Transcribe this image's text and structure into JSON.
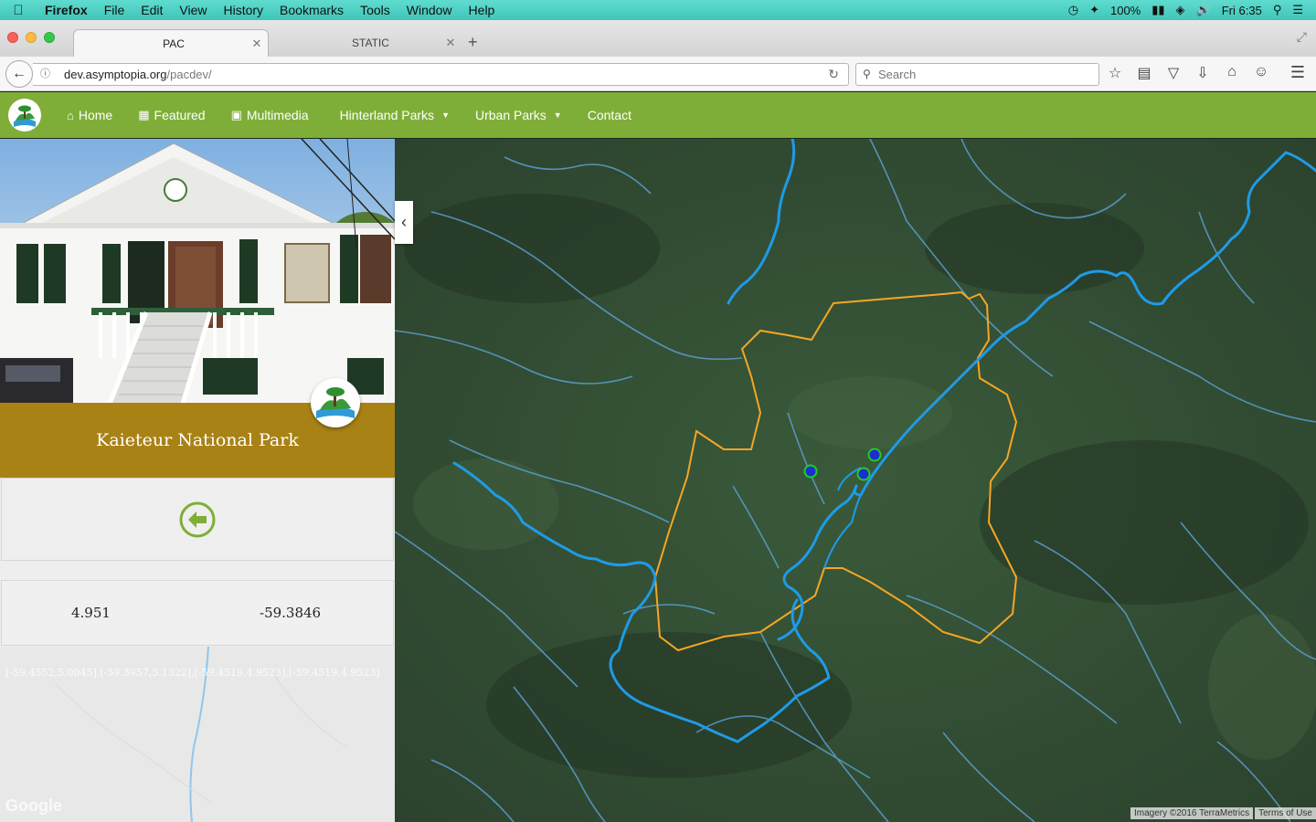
{
  "os_menubar": {
    "app": "Firefox",
    "items": [
      "File",
      "Edit",
      "View",
      "History",
      "Bookmarks",
      "Tools",
      "Window",
      "Help"
    ],
    "battery": "100%",
    "clock": "Fri 6:35"
  },
  "browser": {
    "tabs": [
      {
        "label": "PAC",
        "active": true
      },
      {
        "label": "STATIC",
        "active": false
      }
    ],
    "url_host": "dev.asymptopia.org",
    "url_path": "/pacdev/",
    "search_placeholder": "Search"
  },
  "site_nav": {
    "items": [
      {
        "label": "Home",
        "icon": "home-icon"
      },
      {
        "label": "Featured",
        "icon": "film-icon"
      },
      {
        "label": "Multimedia",
        "icon": "image-icon"
      },
      {
        "label": "Hinterland Parks",
        "dropdown": true
      },
      {
        "label": "Urban Parks",
        "dropdown": true
      },
      {
        "label": "Contact"
      }
    ],
    "accent_color": "#7fae38"
  },
  "park": {
    "name": "Kaieteur National Park",
    "latitude": "4.951",
    "longitude": "-59.3846",
    "coordinate_string": "[-59.4552,5.0045],[-59.3957,5.1322],[-59.4519,4.9523],[-59.4519,4.9523]",
    "band_color": "#a98216"
  },
  "map": {
    "google_logo": "Google",
    "imagery_credit": "Imagery ©2016 TerraMetrics",
    "terms": "Terms of Use",
    "boundary_color": "#f5a623",
    "river_color": "#1e9be8"
  }
}
